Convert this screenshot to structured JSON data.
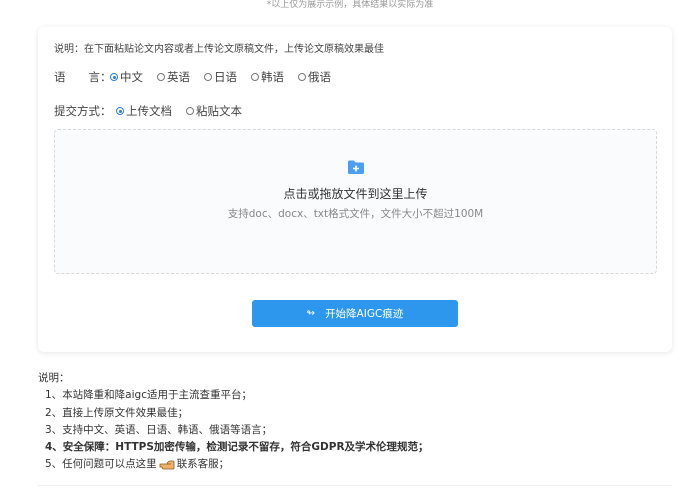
{
  "top_note": "*以上仅为展示示例，具体结果以实际为准",
  "intro": "说明：在下面粘贴论文内容或者上传论文原稿文件，上传论文原稿效果最佳",
  "language": {
    "label": "语　　言：",
    "options": [
      "中文",
      "英语",
      "日语",
      "韩语",
      "俄语"
    ],
    "selected": "中文"
  },
  "submit_method": {
    "label": "提交方式：",
    "options": [
      "上传文档",
      "粘贴文本"
    ],
    "selected": "上传文档"
  },
  "dropzone": {
    "title": "点击或拖放文件到这里上传",
    "hint": "支持doc、docx、txt格式文件，文件大小不超过100M",
    "icon": "folder-plus-icon"
  },
  "start_button": {
    "label": "开始降AIGC痕迹",
    "icon": "arrow-icon"
  },
  "notes": {
    "title": "说明：",
    "items": [
      "1、本站降重和降aigc适用于主流查重平台；",
      "2、直接上传原文件效果最佳；",
      "3、支持中文、英语、日语、韩语、俄语等语言；",
      "4、安全保障：HTTPS加密传输，检测记录不留存，符合GDPR及学术伦理规范；",
      "5、任何问题可以点这里",
      "联系客服；"
    ]
  },
  "colors": {
    "accent": "#2d97ee",
    "folder": "#4a9ff5"
  }
}
